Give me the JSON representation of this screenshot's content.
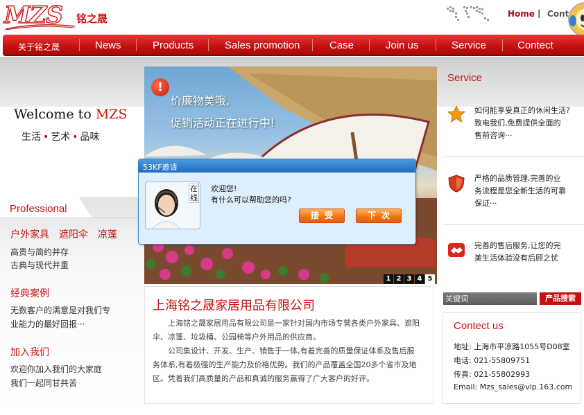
{
  "header": {
    "logo_text": "MZS",
    "logo_cn": "铭之晟",
    "top_links": {
      "home": "Home",
      "separator": "|",
      "contact": "Cont"
    }
  },
  "nav": {
    "items": [
      {
        "label": "关于铭之晟"
      },
      {
        "label": "News"
      },
      {
        "label": "Products"
      },
      {
        "label": "Sales promotion"
      },
      {
        "label": "Case"
      },
      {
        "label": "Join us"
      },
      {
        "label": "Service"
      },
      {
        "label": "Contect"
      }
    ]
  },
  "welcome": {
    "title_prefix": "Welcome to",
    "title_brand": "MZS",
    "motto": [
      "生活",
      "艺术",
      "品味"
    ],
    "motto_dot": "•"
  },
  "sidebar": {
    "professional_title": "Professional",
    "product_categories": [
      "户外家具",
      "遮阳伞",
      "凉蓬"
    ],
    "product_lines": [
      "高贵与简约并存",
      "古典与现代并重"
    ],
    "cases_title": "经典案例",
    "cases_lines": [
      "无数客户的满意是对我们专",
      "业能力的最好回报···"
    ],
    "join_title": "加入我们",
    "join_lines": [
      "欢迎你加入我们的大家庭",
      "我们一起同甘共苦"
    ]
  },
  "banner": {
    "alert_glyph": "!",
    "line1": "价廉物美哦,",
    "line2": "促销活动正在进行中!",
    "pager": [
      "1",
      "2",
      "3",
      "4",
      "5"
    ],
    "active_page": "5"
  },
  "chat": {
    "title": "53KF邀请",
    "online_label": "在线",
    "greeting1": "欢迎您!",
    "greeting2": "有什么可以帮助您的吗?",
    "accept_label": "接受",
    "later_label": "下次"
  },
  "intro": {
    "title": "上海铭之晟家居用品有限公司",
    "paragraph1_line1": "上海铭之晟家居用品有限公司是一家针对国内市场专营各类户外家具、遮阳",
    "paragraph1_line2": "伞、凉蓬、垃圾桶、公园椅等户外用品的供应商。",
    "paragraph2_line1": "公司集设计、开发、生产、销售于一体,有着完善的质量保证体系及售后服",
    "paragraph2_line2": "务体系,有着极强的生产能力及价格优势。我们的产品覆盖全国20多个省市及地",
    "paragraph2_line3": "区。凭着我们高质量的产品和真诚的服务赢得了广大客户的好评。"
  },
  "service": {
    "title": "Service",
    "items": [
      {
        "icon": "star-icon",
        "lines": [
          "如何能享受真正的休闲生活?",
          "致电我们,免费提供全面的",
          "售前咨询···"
        ]
      },
      {
        "icon": "shield-icon",
        "lines": [
          "严格的品质管理,完善的业",
          "务流程是您全新生活的可靠",
          "保证···"
        ]
      },
      {
        "icon": "handshake-icon",
        "lines": [
          "完善的售后服务,让您的完",
          "美生活体验没有后顾之忧"
        ]
      }
    ]
  },
  "search": {
    "placeholder": "关键词",
    "button_label": "产品搜索"
  },
  "contact": {
    "title": "Contect us",
    "address": "地址: 上海市平凉路1055号D08室",
    "phone": "电话: 021-55809751",
    "fax": "传真: 021-55802993",
    "email": "Email: Mzs_sales@vip.163.com"
  },
  "colors": {
    "brand_red": "#c41212",
    "nav_red": "#d41a1a",
    "chat_blue": "#2f78c8",
    "button_orange": "#f2741a"
  }
}
